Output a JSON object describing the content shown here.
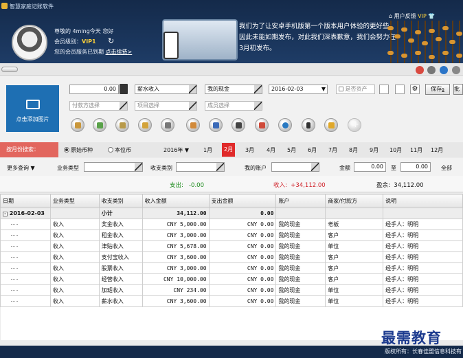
{
  "app": {
    "title": "智慧家庭记账软件"
  },
  "user": {
    "greeting": "尊敬的 4ming今天 您好",
    "level_label": "会员级别：",
    "level": "VIP1",
    "expired": "您的会员服务已到期",
    "renew": "点击续费>"
  },
  "notice": "我们为了让安卓手机版第一个版本用户体验的更好些，因此未能如期发布，对此我们深表歉意，我们会努力在3月初发布。",
  "feedback": {
    "label": "用户反馈",
    "vip": "VIP"
  },
  "entry": {
    "amount": "0.00",
    "income_type": "薪水收入",
    "account": "我的现金",
    "date": "2016-02-03",
    "asset_label": "是否资产",
    "save": "保存",
    "save_shortcut": "s",
    "batch": "批",
    "payer_placeholder": "付款方选择",
    "project_placeholder": "项目选择",
    "member_placeholder": "成员选择",
    "add_image": "点击添加图片"
  },
  "month_search": {
    "label": "按月份搜索：",
    "radio_original": "原始币种",
    "radio_base": "本位币",
    "year": "2016年",
    "months": [
      "1月",
      "2月",
      "3月",
      "4月",
      "5月",
      "6月",
      "7月",
      "8月",
      "9月",
      "10月",
      "11月",
      "12月"
    ],
    "active_month": "2月"
  },
  "filters": {
    "more": "更多查询",
    "biz_type": "业务类型",
    "category": "收支类别",
    "my_account": "我的账户",
    "amount": "金额",
    "from": "0.00",
    "to_label": "至",
    "to": "0.00",
    "all": "全部"
  },
  "summary": {
    "expense_label": "支出:",
    "expense": "-0.00",
    "income_label": "收入:",
    "income": "+34,112.00",
    "balance_label": "盈余:",
    "balance": "34,112.00"
  },
  "table": {
    "headers": [
      "日期",
      "业务类型",
      "收支类别",
      "收入金额",
      "支出金额",
      "账户",
      "商家/付款方",
      "说明"
    ],
    "group": {
      "date": "2016-02-03",
      "subtotal_label": "小计",
      "income": "34,112.00",
      "expense": "0.00"
    },
    "rows": [
      [
        "收入",
        "奖金收入",
        "CNY 5,000.00",
        "CNY 0.00",
        "我的现金",
        "老板",
        "经手人：明明"
      ],
      [
        "收入",
        "租金收入",
        "CNY 3,000.00",
        "CNY 0.00",
        "我的现金",
        "客户",
        "经手人：明明"
      ],
      [
        "收入",
        "津贴收入",
        "CNY 5,678.00",
        "CNY 0.00",
        "我的现金",
        "单位",
        "经手人：明明"
      ],
      [
        "收入",
        "支付宝收入",
        "CNY 3,600.00",
        "CNY 0.00",
        "我的现金",
        "客户",
        "经手人：明明"
      ],
      [
        "收入",
        "股票收入",
        "CNY 3,000.00",
        "CNY 0.00",
        "我的现金",
        "客户",
        "经手人：明明"
      ],
      [
        "收入",
        "经营收入",
        "CNY 10,000.00",
        "CNY 0.00",
        "我的现金",
        "客户",
        "经手人：明明"
      ],
      [
        "收入",
        "加班收入",
        "CNY 234.00",
        "CNY 0.00",
        "我的现金",
        "单位",
        "经手人：明明"
      ],
      [
        "收入",
        "薪水收入",
        "CNY 3,600.00",
        "CNY 0.00",
        "我的现金",
        "单位",
        "经手人：明明"
      ]
    ]
  },
  "footer": "版权所有：长春佳盟信息科技有",
  "watermark": "最需教育",
  "colors": {
    "header": "#1e3c66",
    "accent": "#e02a2a",
    "income": "#d0222a",
    "expense": "#1a8a1a",
    "add_image": "#1e6fb3"
  },
  "icons": [
    "folder-icon",
    "money-icon",
    "scale-icon",
    "coins-icon",
    "calculator-icon",
    "chart-icon",
    "shield-icon",
    "person-icon",
    "trend-icon",
    "globe-icon",
    "phone-icon",
    "gold-icon",
    "plus-icon"
  ]
}
